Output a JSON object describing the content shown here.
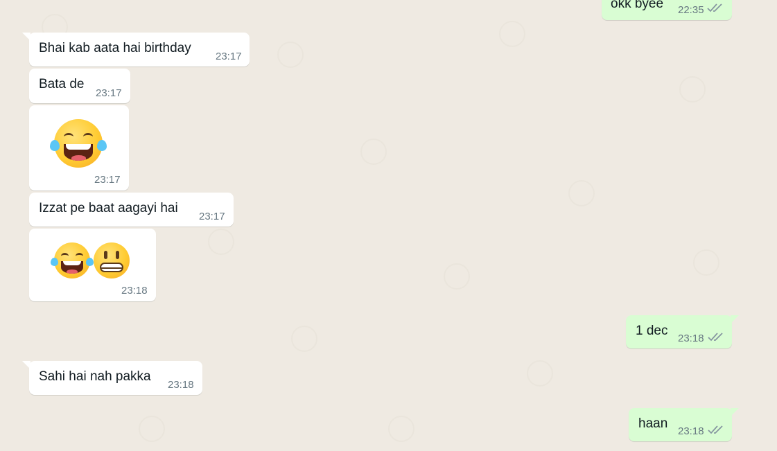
{
  "chat": {
    "messages": [
      {
        "direction": "outgoing",
        "text": "okk byee",
        "time": "22:35",
        "status": "read"
      },
      {
        "direction": "incoming",
        "text": "Bhai kab aata hai birthday",
        "time": "23:17"
      },
      {
        "direction": "incoming",
        "text": "Bata de",
        "time": "23:17"
      },
      {
        "direction": "incoming",
        "emoji": [
          "tears-of-joy"
        ],
        "time": "23:17"
      },
      {
        "direction": "incoming",
        "text": "Izzat pe baat aagayi hai",
        "time": "23:17"
      },
      {
        "direction": "incoming",
        "emoji": [
          "tears-of-joy",
          "grimacing"
        ],
        "time": "23:18"
      },
      {
        "direction": "outgoing",
        "text": "1 dec",
        "time": "23:18",
        "status": "read"
      },
      {
        "direction": "incoming",
        "text": "Sahi hai nah pakka",
        "time": "23:18"
      },
      {
        "direction": "outgoing",
        "text": "haan",
        "time": "23:18",
        "status": "read"
      }
    ]
  },
  "colors": {
    "background": "#efeae2",
    "incoming_bubble": "#ffffff",
    "outgoing_bubble": "#d9fdd3",
    "read_ticks": "#8696a0",
    "timestamp": "#667781"
  }
}
